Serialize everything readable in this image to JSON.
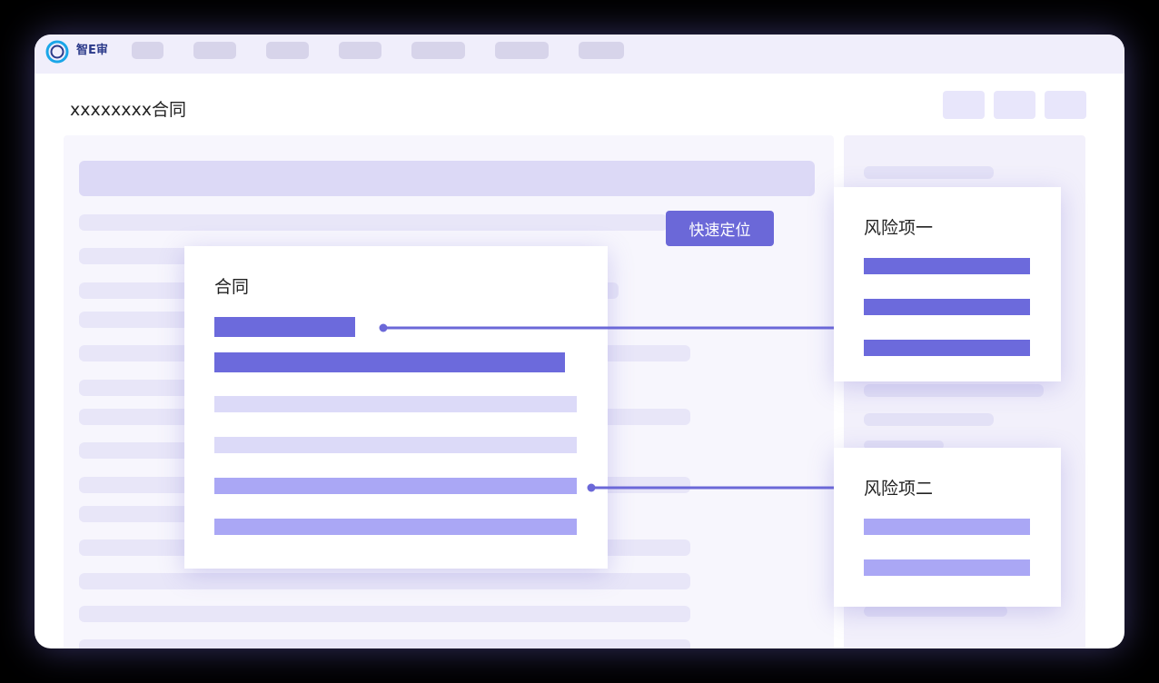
{
  "app": {
    "brand": "智E审",
    "logo_icon": "ring-logo-icon",
    "nav_count": 7
  },
  "document": {
    "title": "xxxxxxxx合同"
  },
  "locate_button": {
    "label": "快速定位"
  },
  "contract_card": {
    "title": "合同"
  },
  "risk_cards": [
    {
      "title": "风险项一"
    },
    {
      "title": "风险项二"
    }
  ],
  "colors": {
    "accent": "#6b68d8",
    "accent_light": "#aaa7f5",
    "highlight_pale": "#dcdaf8",
    "topbar": "#f0eefb",
    "panel": "#f7f6fd"
  }
}
